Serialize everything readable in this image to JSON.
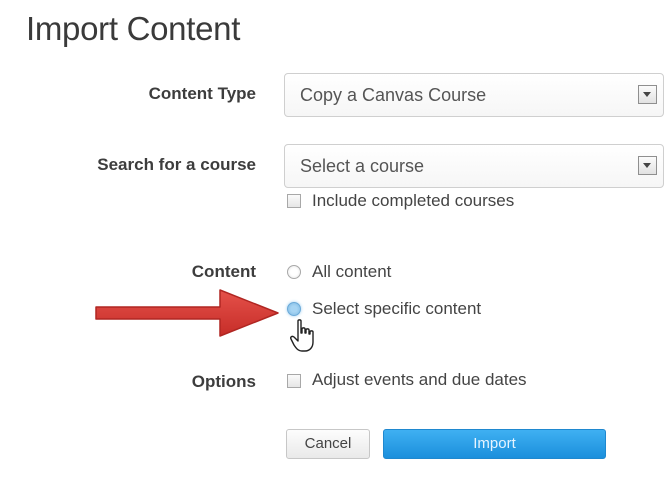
{
  "page": {
    "title": "Import Content"
  },
  "form": {
    "content_type": {
      "label": "Content Type",
      "value": "Copy a Canvas Course"
    },
    "search": {
      "label": "Search for a course",
      "value": "Select a course",
      "include_completed": {
        "label": "Include completed courses",
        "checked": false
      }
    },
    "content": {
      "label": "Content",
      "options": [
        {
          "label": "All content",
          "selected": false
        },
        {
          "label": "Select specific content",
          "selected": true
        }
      ]
    },
    "options": {
      "label": "Options",
      "adjust_dates": {
        "label": "Adjust events and due dates",
        "checked": false
      }
    }
  },
  "buttons": {
    "cancel_label": "Cancel",
    "import_label": "Import"
  },
  "colors": {
    "accent": "#1b8fdc",
    "arrow": "#d93a34"
  },
  "annotations": {
    "arrow_icon": "red-arrow-icon",
    "cursor_icon": "hand-cursor-icon"
  }
}
